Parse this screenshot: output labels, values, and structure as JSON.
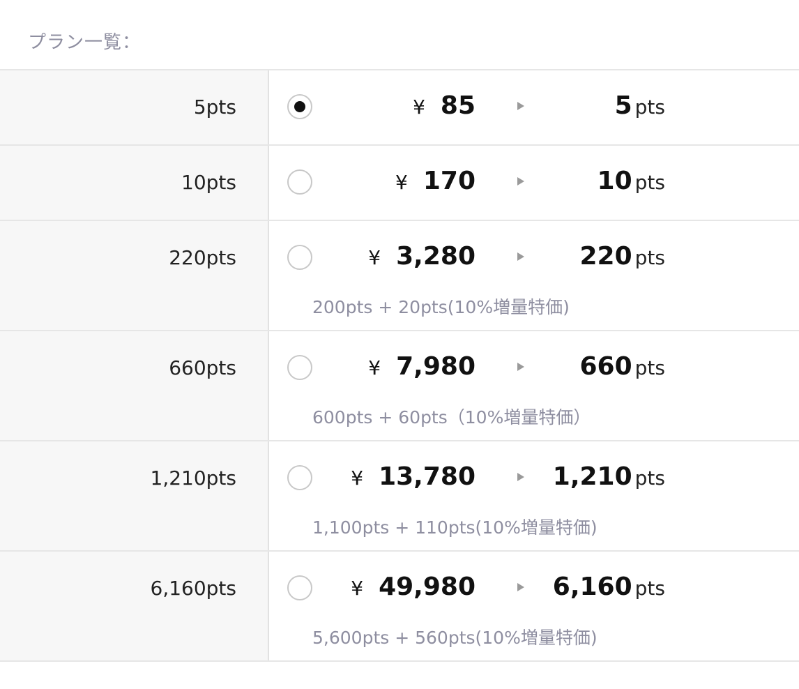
{
  "header": {
    "label": "プラン一覧："
  },
  "plans": [
    {
      "label": "5pts",
      "selected": true,
      "yen": "¥",
      "price": "85",
      "points": "5",
      "unit": "pts",
      "note": ""
    },
    {
      "label": "10pts",
      "selected": false,
      "yen": "¥",
      "price": "170",
      "points": "10",
      "unit": "pts",
      "note": ""
    },
    {
      "label": "220pts",
      "selected": false,
      "yen": "¥",
      "price": "3,280",
      "points": "220",
      "unit": "pts",
      "note": "200pts + 20pts(10%増量特価)"
    },
    {
      "label": "660pts",
      "selected": false,
      "yen": "¥",
      "price": "7,980",
      "points": "660",
      "unit": "pts",
      "note": "600pts + 60pts（10%増量特価）"
    },
    {
      "label": "1,210pts",
      "selected": false,
      "yen": "¥",
      "price": "13,780",
      "points": "1,210",
      "unit": "pts",
      "note": "1,100pts + 110pts(10%増量特価)"
    },
    {
      "label": "6,160pts",
      "selected": false,
      "yen": "¥",
      "price": "49,980",
      "points": "6,160",
      "unit": "pts",
      "note": "5,600pts + 560pts(10%増量特価)"
    }
  ]
}
